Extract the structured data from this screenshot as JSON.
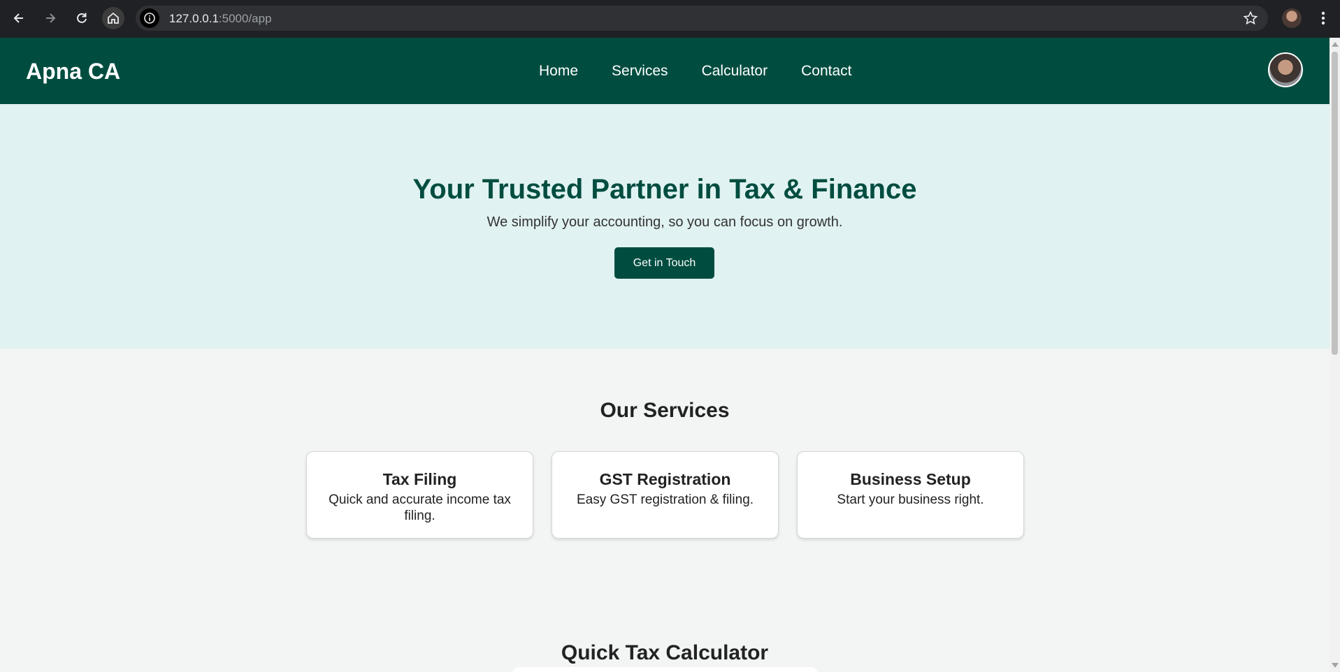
{
  "browser": {
    "url_host": "127.0.0.1",
    "url_path": ":5000/app"
  },
  "site": {
    "brand": "Apna CA",
    "nav": [
      {
        "label": "Home"
      },
      {
        "label": "Services"
      },
      {
        "label": "Calculator"
      },
      {
        "label": "Contact"
      }
    ]
  },
  "hero": {
    "title": "Your Trusted Partner in Tax & Finance",
    "subtitle": "We simplify your accounting, so you can focus on growth.",
    "cta_label": "Get in Touch"
  },
  "services": {
    "title": "Our Services",
    "items": [
      {
        "title": "Tax Filing",
        "description": "Quick and accurate income tax filing."
      },
      {
        "title": "GST Registration",
        "description": "Easy GST registration & filing."
      },
      {
        "title": "Business Setup",
        "description": "Start your business right."
      }
    ]
  },
  "calculator": {
    "title": "Quick Tax Calculator"
  },
  "colors": {
    "primary": "#004d40",
    "hero_bg": "#e0f2f1",
    "page_bg": "#f2f5f4"
  }
}
